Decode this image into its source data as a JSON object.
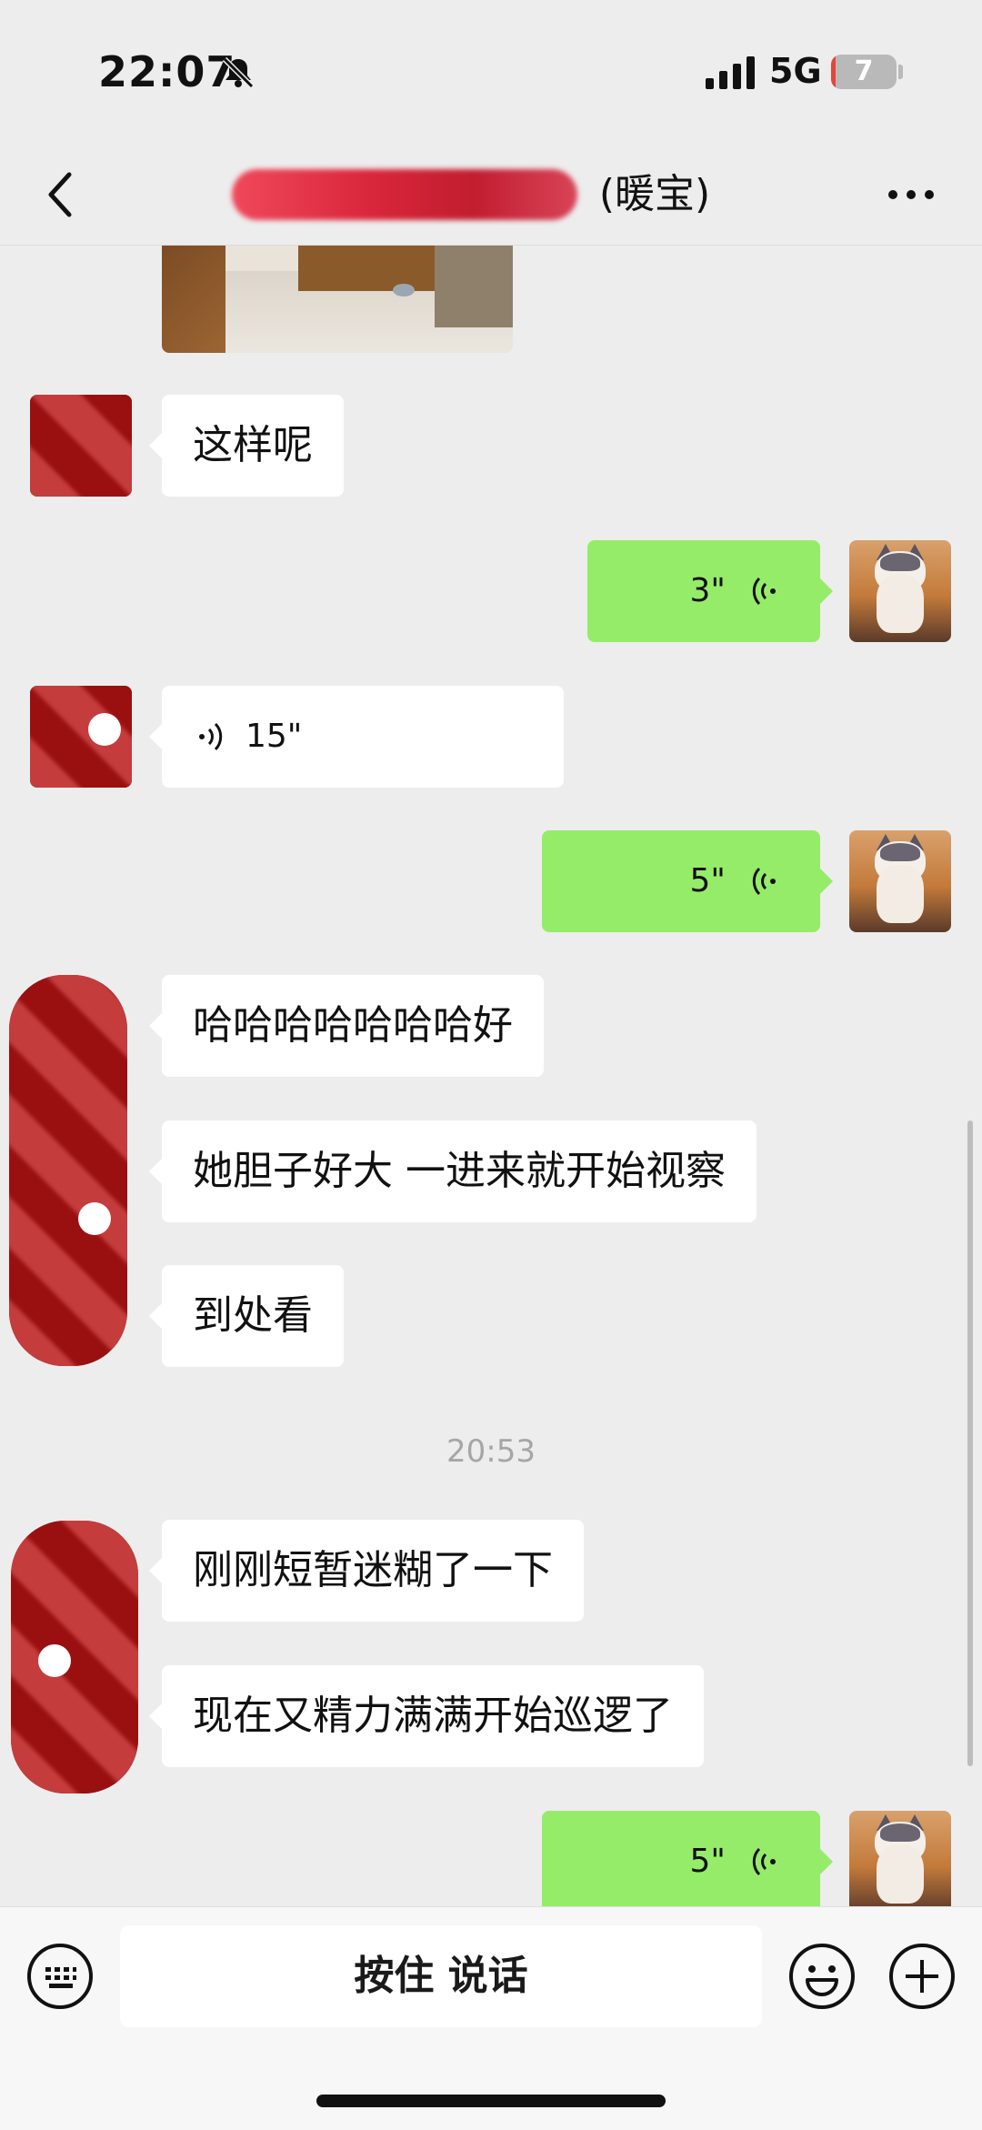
{
  "status_bar": {
    "time": "22:07",
    "network": "5G",
    "battery": "7",
    "battery_level_percent": 7,
    "icons": [
      "bell-muted-icon",
      "signal-icon"
    ]
  },
  "nav": {
    "title": "(暖宝)",
    "back_icon": "chevron-left-icon",
    "more_icon": "more-dots-icon"
  },
  "messages": {
    "m1": {
      "text": "这样呢"
    },
    "m2": {
      "duration": "3\""
    },
    "m3": {
      "duration": "15\""
    },
    "m4": {
      "duration": "5\""
    },
    "m5": {
      "text": "哈哈哈哈哈哈哈好"
    },
    "m6": {
      "text": "她胆子好大 一进来就开始视察"
    },
    "m7": {
      "text": "到处看"
    },
    "divider": "20:53",
    "m8": {
      "text": "刚刚短暂迷糊了一下"
    },
    "m9": {
      "text": "现在又精力满满开始巡逻了"
    },
    "m10": {
      "duration": "5\""
    }
  },
  "input_bar": {
    "talk_label": "按住 说话",
    "icons": [
      "keyboard-icon",
      "emoji-icon",
      "plus-icon"
    ]
  },
  "colors": {
    "background": "#ededed",
    "bubble_out": "#95ec69",
    "bubble_in": "#ffffff"
  }
}
